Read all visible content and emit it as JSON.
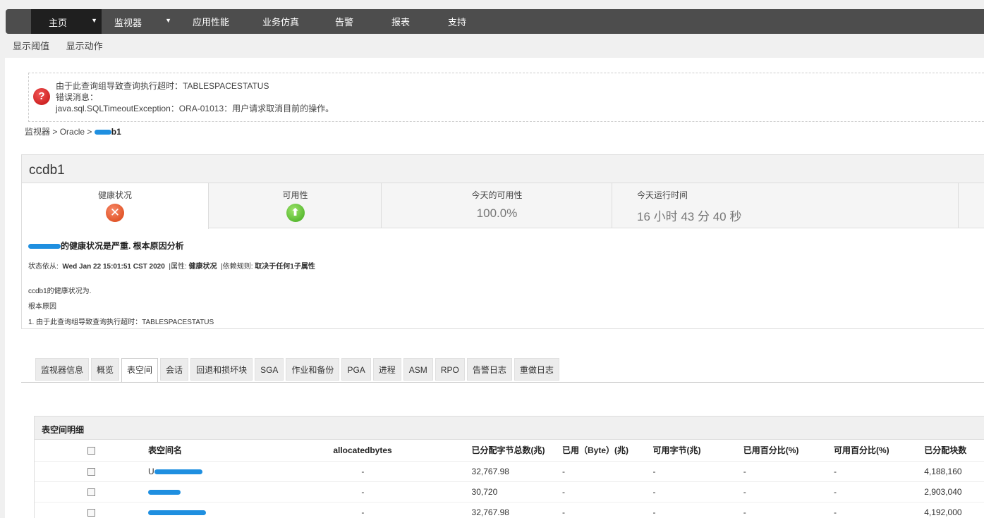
{
  "nav": {
    "home": "主页",
    "monitors": "监视器",
    "apm": "应用性能",
    "simulation": "业务仿真",
    "alarms": "告警",
    "reports": "报表",
    "support": "支持"
  },
  "submenu": {
    "thresholds": "显示阈值",
    "actions": "显示动作"
  },
  "error": {
    "line1": "由于此查询组导致查询执行超时：TABLESPACESTATUS",
    "line2": "错误消息：",
    "line3": "java.sql.SQLTimeoutException：ORA-01013：用户请求取消目前的操作。"
  },
  "breadcrumb": {
    "root": "监视器",
    "sep": " > ",
    "type": "Oracle",
    "current": "b1"
  },
  "monitor": {
    "name": "ccdb1",
    "health_label": "健康状况",
    "availability_label": "可用性",
    "today_availability_label": "今天的可用性",
    "today_availability_value": "100.0%",
    "uptime_label": "今天运行时间",
    "uptime_value": "16 小时 43 分 40 秒"
  },
  "rca": {
    "title": "的健康状况是严重. 根本原因分析",
    "status_label": "状态依从:",
    "status_time": "Wed Jan 22 15:01:51 CST 2020",
    "attr_label": "|属性:",
    "attr_value": "健康状况",
    "rule_label": "|依赖规则:",
    "rule_value": "取决于任何1子属性",
    "health_is": "ccdb1的健康状况为.",
    "root_cause": "根本原因",
    "cause1": "1. 由于此查询组导致查询执行超时：TABLESPACESTATUS"
  },
  "tabs": [
    "监视器信息",
    "概览",
    "表空间",
    "会话",
    "回退和损坏块",
    "SGA",
    "作业和备份",
    "PGA",
    "进程",
    "ASM",
    "RPO",
    "告警日志",
    "重做日志"
  ],
  "table": {
    "title": "表空间明细",
    "headers": [
      "表空间名",
      "allocatedbytes",
      "已分配字节总数(兆)",
      "已用（Byte）(兆)",
      "可用字节(兆)",
      "已用百分比(%)",
      "可用百分比(%)",
      "已分配块数"
    ],
    "rows": [
      {
        "name": "U",
        "allocatedbytes": "-",
        "allocated_mb": "32,767.98",
        "used": "-",
        "free": "-",
        "used_pct": "-",
        "free_pct": "-",
        "blocks": "4,188,160"
      },
      {
        "name": "",
        "allocatedbytes": "-",
        "allocated_mb": "30,720",
        "used": "-",
        "free": "-",
        "used_pct": "-",
        "free_pct": "-",
        "blocks": "2,903,040"
      },
      {
        "name": "",
        "allocatedbytes": "-",
        "allocated_mb": "32,767.98",
        "used": "-",
        "free": "-",
        "used_pct": "-",
        "free_pct": "-",
        "blocks": "4,192,000"
      }
    ]
  }
}
